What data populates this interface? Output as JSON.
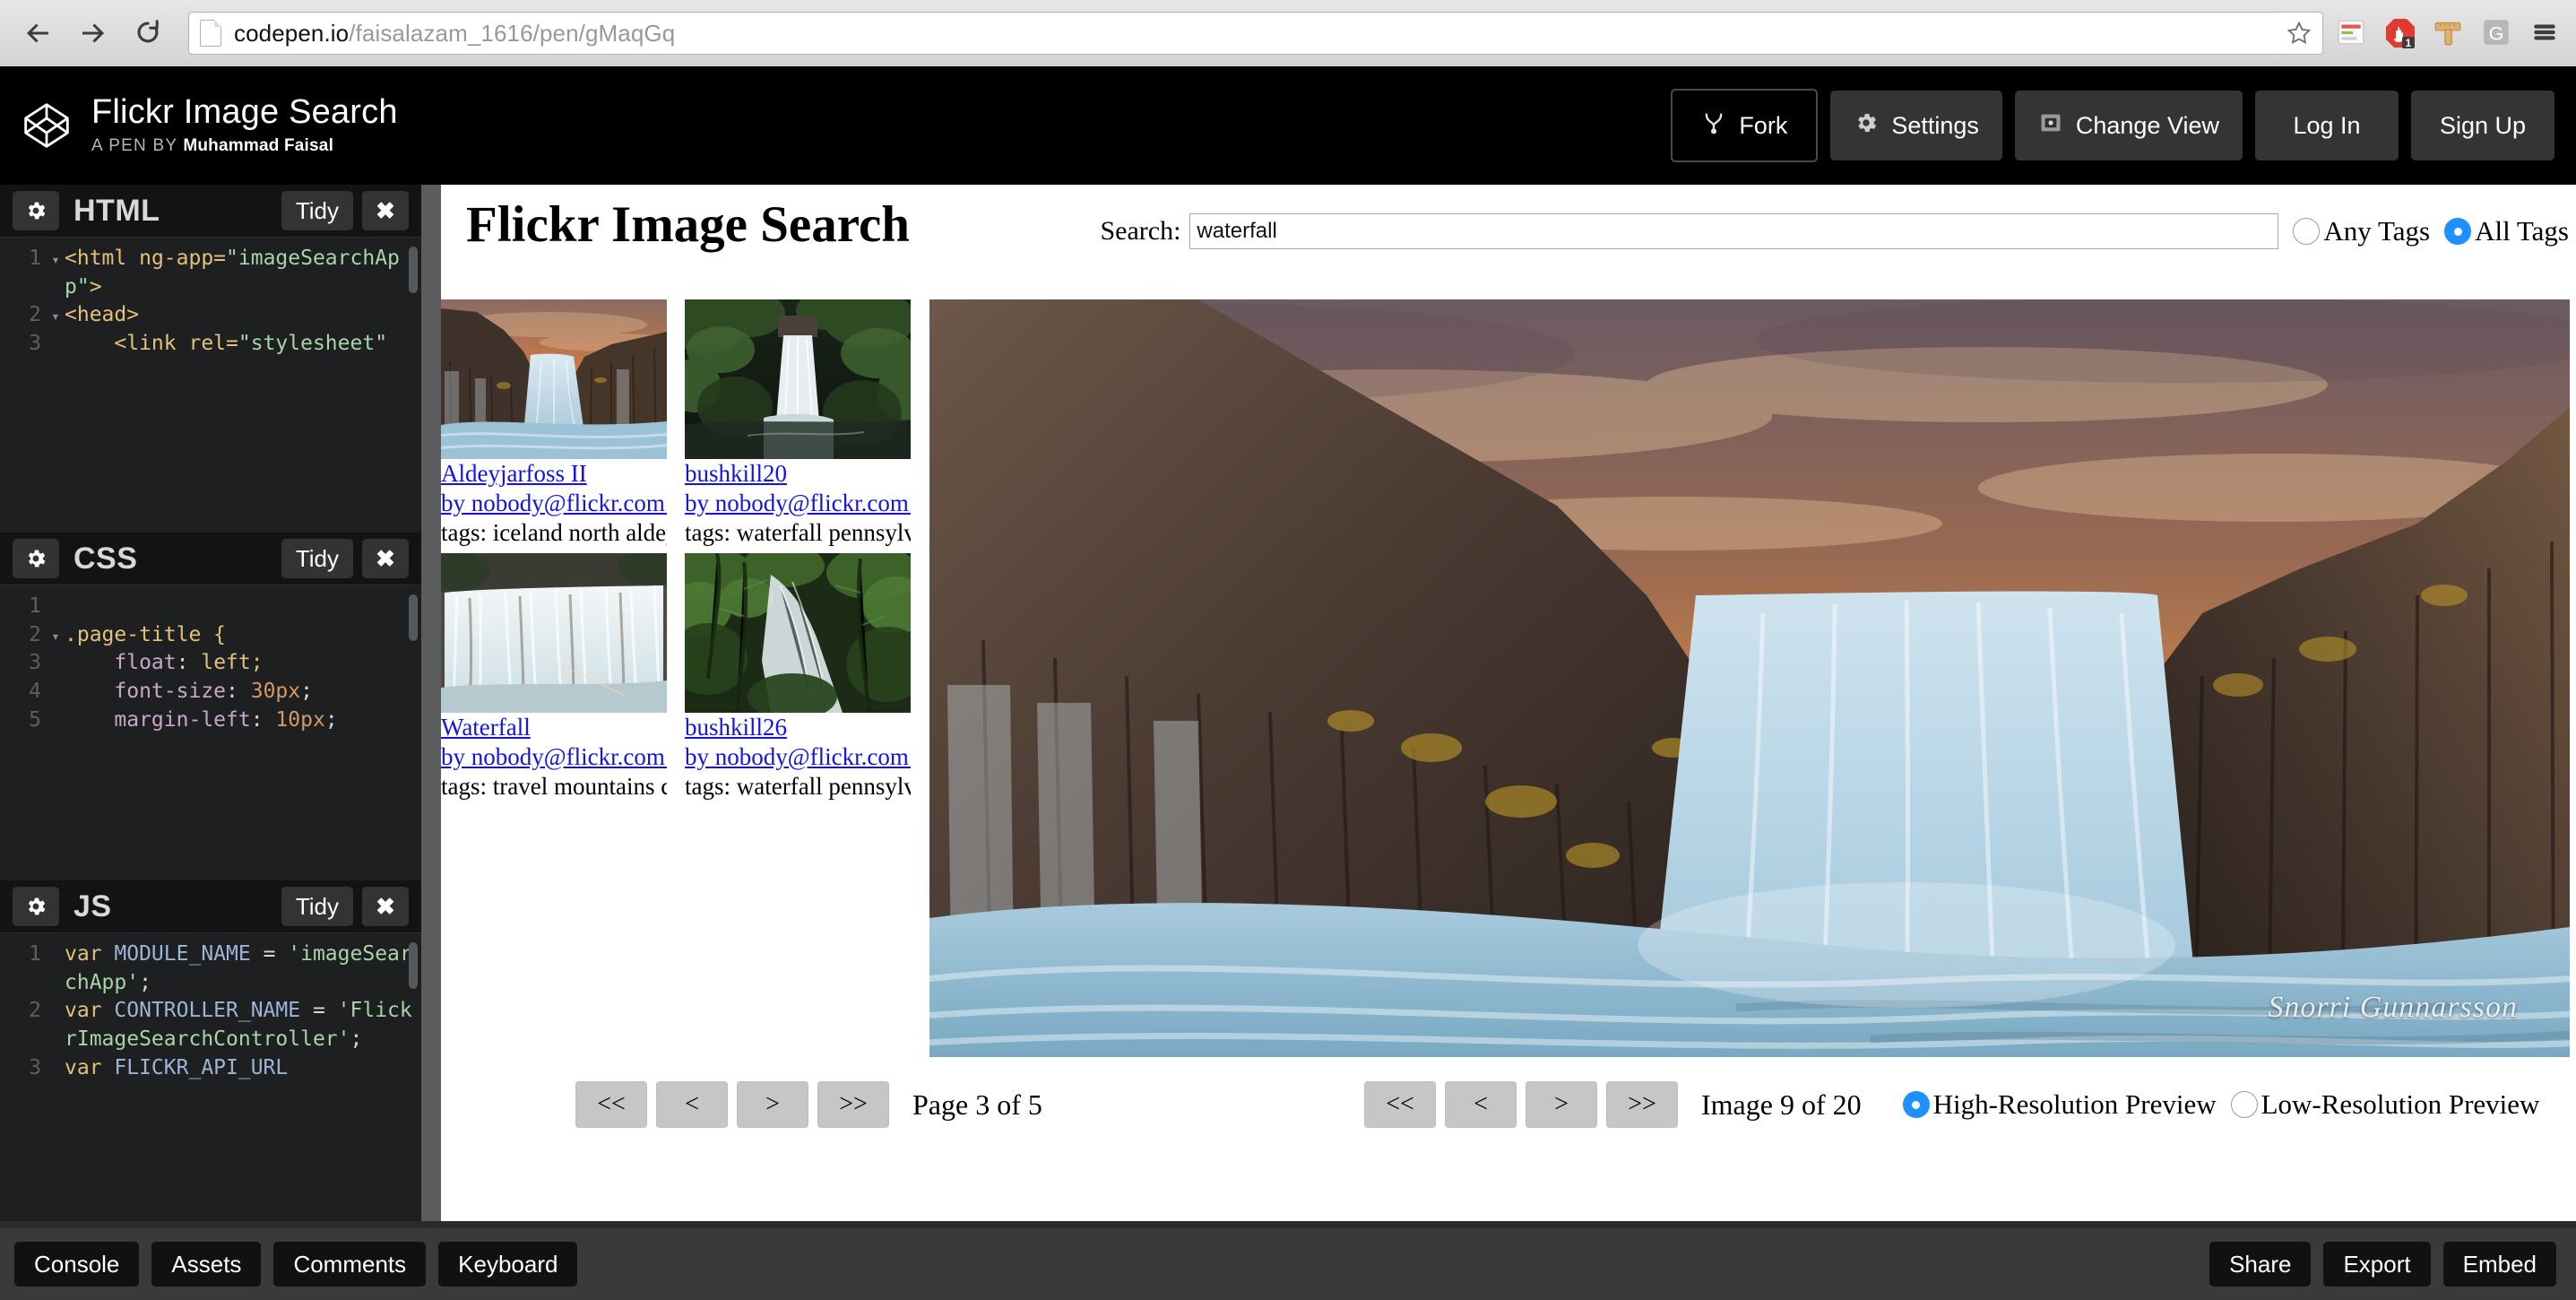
{
  "browser": {
    "url_domain": "codepen.io",
    "url_path": "/faisalazam_1616/pen/gMaqGq",
    "back_icon": "back-arrow-icon",
    "forward_icon": "forward-arrow-icon",
    "reload_icon": "reload-icon",
    "bookmark_icon": "star-icon",
    "extensions": [
      "reader-icon",
      "adblock-icon",
      "ruler-icon",
      "grammarly-icon",
      "menu-icon"
    ],
    "adblock_badge": "1"
  },
  "pen_header": {
    "logo": "codepen-logo",
    "title": "Flickr Image Search",
    "byline_prefix": "A PEN BY",
    "author": "Muhammad Faisal",
    "buttons": [
      {
        "label": "Fork",
        "icon": "fork-icon"
      },
      {
        "label": "Settings",
        "icon": "gear-icon"
      },
      {
        "label": "Change View",
        "icon": "layout-icon"
      },
      {
        "label": "Log In",
        "icon": ""
      },
      {
        "label": "Sign Up",
        "icon": ""
      }
    ]
  },
  "editors": [
    {
      "name": "HTML",
      "tidy": "Tidy",
      "close": "✖",
      "gear": "gear-icon",
      "lines": [
        {
          "num": "1",
          "fold": "▾",
          "tokens": [
            {
              "t": "<html ",
              "c": "tk-tag"
            },
            {
              "t": "ng-app=",
              "c": "tk-attr"
            },
            {
              "t": "\"imageSearchApp\"",
              "c": "tk-str"
            },
            {
              "t": ">",
              "c": "tk-tag"
            }
          ]
        },
        {
          "num": "2",
          "fold": "▾",
          "tokens": [
            {
              "t": "<head>",
              "c": "tk-tag"
            }
          ]
        },
        {
          "num": "3",
          "fold": "",
          "tokens": [
            {
              "t": "    <link ",
              "c": "tk-tag"
            },
            {
              "t": "rel=",
              "c": "tk-attr"
            },
            {
              "t": "\"stylesheet\"",
              "c": "tk-str"
            }
          ]
        }
      ]
    },
    {
      "name": "CSS",
      "tidy": "Tidy",
      "close": "✖",
      "gear": "gear-icon",
      "lines": [
        {
          "num": "1",
          "fold": "",
          "tokens": []
        },
        {
          "num": "2",
          "fold": "▾",
          "tokens": [
            {
              "t": ".page-title {",
              "c": "tk-sel"
            }
          ]
        },
        {
          "num": "3",
          "fold": "",
          "tokens": [
            {
              "t": "    float",
              "c": "tk-prop"
            },
            {
              "t": ": ",
              "c": "tk-plain"
            },
            {
              "t": "left;",
              "c": "tk-kw"
            }
          ]
        },
        {
          "num": "4",
          "fold": "",
          "tokens": [
            {
              "t": "    font-size",
              "c": "tk-prop"
            },
            {
              "t": ": ",
              "c": "tk-plain"
            },
            {
              "t": "30px",
              "c": "tk-num"
            },
            {
              "t": ";",
              "c": "tk-plain"
            }
          ]
        },
        {
          "num": "5",
          "fold": "",
          "tokens": [
            {
              "t": "    margin-left",
              "c": "tk-prop"
            },
            {
              "t": ": ",
              "c": "tk-plain"
            },
            {
              "t": "10px",
              "c": "tk-num"
            },
            {
              "t": ";",
              "c": "tk-plain"
            }
          ]
        }
      ]
    },
    {
      "name": "JS",
      "tidy": "Tidy",
      "close": "✖",
      "gear": "gear-icon",
      "lines": [
        {
          "num": "1",
          "fold": "",
          "tokens": [
            {
              "t": "var ",
              "c": "tk-kw"
            },
            {
              "t": "MODULE_NAME",
              "c": "tk-var"
            },
            {
              "t": " = ",
              "c": "tk-plain"
            },
            {
              "t": "'imageSearchApp'",
              "c": "tk-str"
            },
            {
              "t": ";",
              "c": "tk-plain"
            }
          ]
        },
        {
          "num": "2",
          "fold": "",
          "tokens": [
            {
              "t": "var ",
              "c": "tk-kw"
            },
            {
              "t": "CONTROLLER_NAME",
              "c": "tk-var"
            },
            {
              "t": " = ",
              "c": "tk-plain"
            },
            {
              "t": "'FlickrImageSearchController'",
              "c": "tk-str"
            },
            {
              "t": ";",
              "c": "tk-plain"
            }
          ]
        },
        {
          "num": "3",
          "fold": "",
          "tokens": [
            {
              "t": "var ",
              "c": "tk-kw"
            },
            {
              "t": "FLICKR_API_URL",
              "c": "tk-var"
            }
          ]
        }
      ]
    }
  ],
  "preview": {
    "page_title": "Flickr Image Search",
    "search_label": "Search:",
    "search_value": "waterfall",
    "search_placeholder": "",
    "tag_modes": [
      {
        "label": "Any Tags",
        "selected": false
      },
      {
        "label": "All Tags",
        "selected": true
      }
    ],
    "thumbnails": [
      {
        "title": "Aldeyjarfoss II",
        "author": "by nobody@flickr.com (Snorri ",
        "author_ellipsis": "...",
        "tags": "tags: iceland north aldeyjarfoss..."
      },
      {
        "title": "bushkill20",
        "author": "by nobody@flickr.com (daily o",
        "author_ellipsis": "...",
        "tags": "tags: waterfall pennsylvania wi..."
      },
      {
        "title": "Waterfall",
        "author": "by nobody@flickr.com (Oleh S",
        "author_ellipsis": "...",
        "tags": "tags: travel mountains color bir..."
      },
      {
        "title": "bushkill26",
        "author": "by nobody@flickr.com (daily o",
        "author_ellipsis": "...",
        "tags": "tags: waterfall pennsylvania wi..."
      }
    ],
    "big_image_watermark": "Snorri Gunnarsson",
    "page_pager": {
      "buttons": [
        "<<",
        "<",
        ">",
        ">>"
      ],
      "status": "Page 3 of 5"
    },
    "image_pager": {
      "buttons": [
        "<<",
        "<",
        ">",
        ">>"
      ],
      "status": "Image 9 of 20"
    },
    "resolutions": [
      {
        "label": "High-Resolution Preview",
        "selected": true
      },
      {
        "label": "Low-Resolution Preview",
        "selected": false
      }
    ],
    "accent_color": "#1e90ff",
    "link_color": "#1412e8"
  },
  "bottom_bar": {
    "left": [
      "Console",
      "Assets",
      "Comments",
      "Keyboard"
    ],
    "right": [
      "Share",
      "Export",
      "Embed"
    ]
  }
}
